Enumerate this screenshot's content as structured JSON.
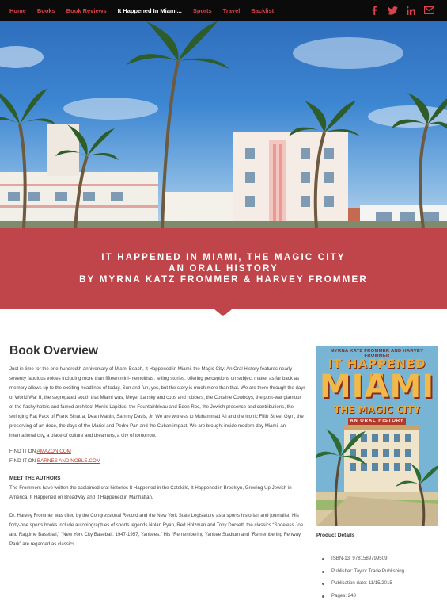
{
  "nav": {
    "items": [
      {
        "label": "Home"
      },
      {
        "label": "Books"
      },
      {
        "label": "Book Reviews"
      },
      {
        "label": "It Happened In Miami..."
      },
      {
        "label": "Sports"
      },
      {
        "label": "Travel"
      },
      {
        "label": "Backlist"
      }
    ],
    "active_index": 3,
    "icons": [
      "facebook-icon",
      "twitter-icon",
      "linkedin-icon",
      "email-icon"
    ],
    "accent_color": "#d9434a"
  },
  "banner": {
    "line1": "IT HAPPENED IN MIAMI, THE MAGIC CITY",
    "line2": "AN ORAL HISTORY",
    "line3": "BY MYRNA KATZ FROMMER & HARVEY FROMMER",
    "color": "#bf454b"
  },
  "overview": {
    "title": "Book Overview",
    "paragraph": "Just in time for the one-hundredth anniversary of Miami Beach, It Happened in Miami, the Magic City: An Oral History features nearly seventy fabulous voices including more than fifteen mini-memoirists, telling stories, offering perceptions on subject matter as far back as memory allows up to the exciting headlines of today. Sun and fun, yes, but the story is much more than that. We are there through the days of World War II, the segregated south that Miami was, Meyer Lansky and cops and robbers, the Cocaine Cowboys, the post-war glamour of the flashy hotels and famed architect Morris Lapidus, the Fountainbleau and Eden Roc, the Jewish presence and contributions, the swinging Rat Pack of Frank Sinatra, Dean Martin, Sammy Davis, Jr. We are witness to Muhammad Ali and the iconic Fifth Street Gym, the preserving of art deco, the days of the Mariel and Pedro Pan and the Cuban impact. We are brought inside modern day Miami–an international city, a place of culture and dreamers, a city of tomorrow.",
    "find_prefix": "FIND IT ON ",
    "find_amazon": "AMAZON.COM",
    "find_bn": "BARNES AND NOBLE.COM",
    "meet_title": "MEET THE AUTHORS",
    "authors_para1": "The Frommers have written the acclaimed oral histories It Happened in the Catskills, It Happened in Brooklyn, Growing Up Jewish in America, It Happened on Broadway and It Happened in Manhattan.",
    "authors_para2": "Dr. Harvey Frommer was cited by the Congressional Record and the New York State Legislature as a sports historian and journalist. His forty-one sports books include autobiographies of sports legends Nolan Ryan, Red Holzman and Tony Dorsett, the classics “Shoeless Joe and Ragtime Baseball,” “New York City Baseball: 1947-1957, Yankees.” His “Remembering Yankee Stadium and “Remembering Fenway Park” are regarded as classics."
  },
  "cover": {
    "authors": "MYRNA KATZ FROMMER AND HARVEY FROMMER",
    "it_happened": "IT HAPPENED IN",
    "miami": "MIAMI",
    "subtitle": "THE MAGIC CITY",
    "oral": "AN ORAL HISTORY"
  },
  "product": {
    "title": "Product Details",
    "details": [
      "ISBN-13: 9781589799509",
      "Publisher: Taylor Trade Publishing",
      "Publication date: 11/15/2015",
      "Pages: 248"
    ]
  }
}
